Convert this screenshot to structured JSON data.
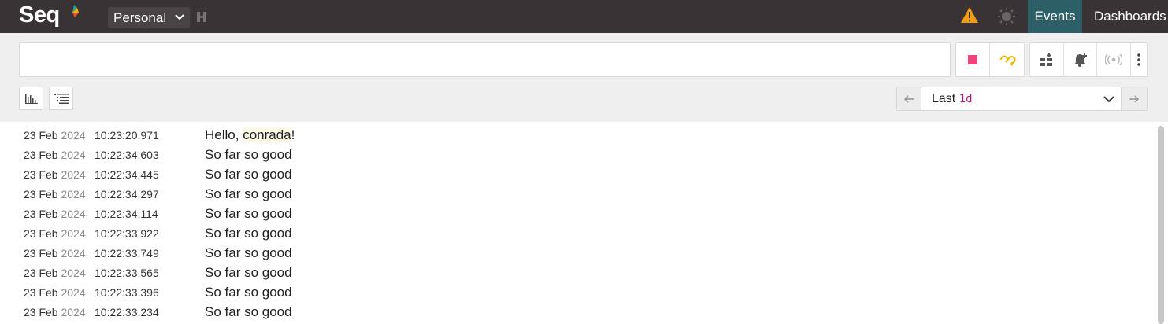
{
  "header": {
    "logo": "Seq",
    "workspace": "Personal",
    "nav": {
      "events": "Events",
      "dashboards": "Dashboards"
    }
  },
  "filter": {
    "search_value": "",
    "search_placeholder": ""
  },
  "range": {
    "prefix": "Last",
    "duration": "1d"
  },
  "icons": {
    "warning": "warning-icon",
    "theme": "theme-toggle-icon",
    "stop": "stop-icon",
    "refresh": "auto-refresh-icon",
    "add_signal": "add-to-dashboard-icon",
    "add_alert": "add-alert-icon",
    "live": "broadcast-icon",
    "more": "more-vertical-icon"
  },
  "colors": {
    "topbar": "#3a3336",
    "active_nav": "#2c5f66",
    "stop": "#f0457a",
    "refresh": "#f0b400",
    "warning": "#f39c12",
    "duration": "#b5147f"
  },
  "events": [
    {
      "date": "23 Feb",
      "year": "2024",
      "time": "10:23:20.971",
      "msg_pre": "Hello, ",
      "msg_hl": "conrada",
      "msg_post": "!"
    },
    {
      "date": "23 Feb",
      "year": "2024",
      "time": "10:22:34.603",
      "msg_pre": "So far so good",
      "msg_hl": "",
      "msg_post": ""
    },
    {
      "date": "23 Feb",
      "year": "2024",
      "time": "10:22:34.445",
      "msg_pre": "So far so good",
      "msg_hl": "",
      "msg_post": ""
    },
    {
      "date": "23 Feb",
      "year": "2024",
      "time": "10:22:34.297",
      "msg_pre": "So far so good",
      "msg_hl": "",
      "msg_post": ""
    },
    {
      "date": "23 Feb",
      "year": "2024",
      "time": "10:22:34.114",
      "msg_pre": "So far so good",
      "msg_hl": "",
      "msg_post": ""
    },
    {
      "date": "23 Feb",
      "year": "2024",
      "time": "10:22:33.922",
      "msg_pre": "So far so good",
      "msg_hl": "",
      "msg_post": ""
    },
    {
      "date": "23 Feb",
      "year": "2024",
      "time": "10:22:33.749",
      "msg_pre": "So far so good",
      "msg_hl": "",
      "msg_post": ""
    },
    {
      "date": "23 Feb",
      "year": "2024",
      "time": "10:22:33.565",
      "msg_pre": "So far so good",
      "msg_hl": "",
      "msg_post": ""
    },
    {
      "date": "23 Feb",
      "year": "2024",
      "time": "10:22:33.396",
      "msg_pre": "So far so good",
      "msg_hl": "",
      "msg_post": ""
    },
    {
      "date": "23 Feb",
      "year": "2024",
      "time": "10:22:33.234",
      "msg_pre": "So far so good",
      "msg_hl": "",
      "msg_post": ""
    }
  ]
}
